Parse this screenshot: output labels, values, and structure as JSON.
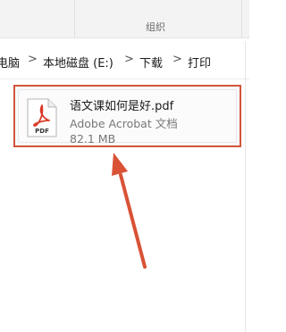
{
  "ribbon": {
    "group_label": "组织"
  },
  "breadcrumb": {
    "items": [
      "电脑",
      "本地磁盘 (E:)",
      "下载",
      "打印"
    ],
    "separator": ">"
  },
  "file": {
    "name": "语文课如何是好.pdf",
    "type": "Adobe Acrobat 文档",
    "size": "82.1 MB",
    "icon": "pdf-file-icon",
    "icon_label": "PDF"
  },
  "colors": {
    "highlight": "#d2553b",
    "pdf_red": "#d93a26"
  },
  "annotation": {
    "arrow_icon": "red-arrow-pointing-up"
  }
}
